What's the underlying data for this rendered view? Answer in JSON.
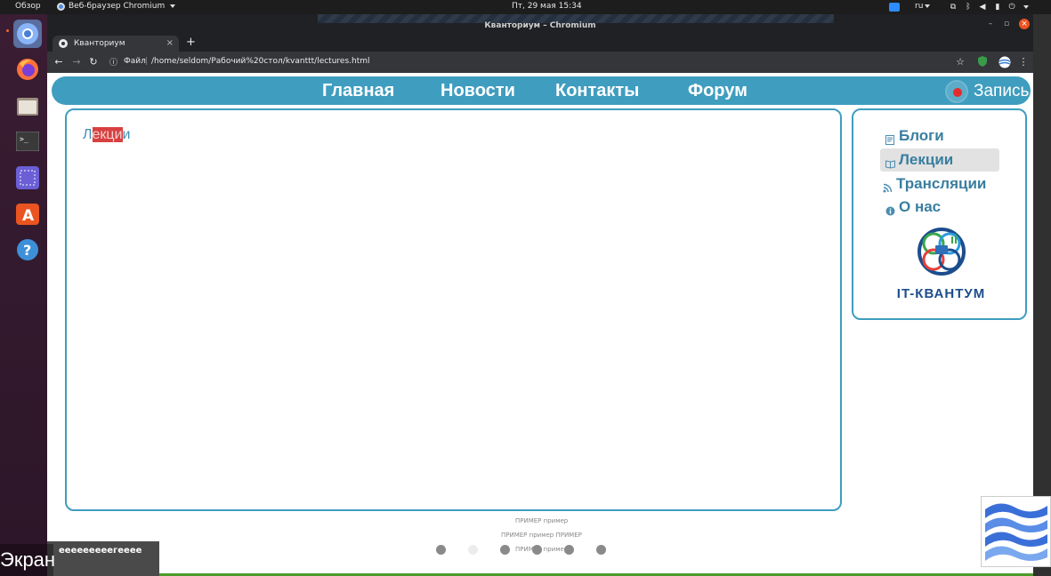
{
  "topbar": {
    "activities": "Обзор",
    "app_name": "Веб-браузер Chromium",
    "clock": "Пт, 29 мая  15:34",
    "lang": "ru"
  },
  "dock": {
    "items": [
      "chromium",
      "firefox",
      "files",
      "terminal",
      "screenshot",
      "software-center",
      "help"
    ]
  },
  "window": {
    "title": "Кванториум – Chromium"
  },
  "browser": {
    "tab_title": "Кванториум",
    "tab_close": "×",
    "new_tab": "+",
    "address_label": "Файл",
    "address_separator": "|",
    "url": "/home/seldom/Рабочий%20стол/kvanttt/lectures.html"
  },
  "page": {
    "nav": [
      "Главная",
      "Новости",
      "Контакты",
      "Форум"
    ],
    "record_label": "Запись",
    "main_heading": {
      "before": "Л",
      "highlight": "екци",
      "after": "и"
    },
    "sidebar": [
      {
        "label": "Блоги",
        "icon": "blog-icon",
        "active": false
      },
      {
        "label": "Лекции",
        "icon": "lectures-icon",
        "active": true
      },
      {
        "label": "Трансляции",
        "icon": "rss-icon",
        "active": false
      },
      {
        "label": "О нас",
        "icon": "info-icon",
        "active": false
      }
    ],
    "logo_text": "IT-КВАНТУМ",
    "footer": {
      "line1": "ПРИМЕР пример",
      "line2": "ПРИМЕР пример ПРИМЕР",
      "line3": "ПРИМЕР пример"
    }
  },
  "overlay": {
    "screen_label": "Экран",
    "participant": "eeeeeeeeeгeeee"
  },
  "colors": {
    "accent": "#3f9dbf",
    "record": "#e52b2b",
    "highlight": "#d94040"
  }
}
